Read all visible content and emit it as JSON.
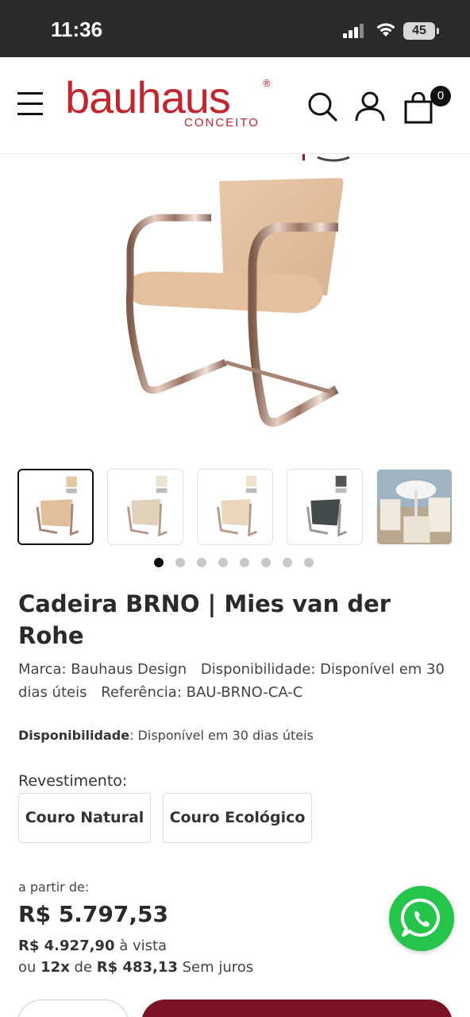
{
  "status_bar": {
    "time": "11:36",
    "battery": "45"
  },
  "header": {
    "logo_main": "bauhaus",
    "logo_sub": "CONCEITO",
    "logo_reg": "®",
    "cart_count": "0"
  },
  "gallery": {
    "thumbnail_count": 5,
    "active_thumbnail": 0,
    "dot_count": 8,
    "active_dot": 0
  },
  "product": {
    "title": "Cadeira BRNO | Mies van der Rohe",
    "brand": "Marca: Bauhaus Design",
    "availability_meta": "Disponibilidade: Disponível em 30 dias úteis",
    "reference": "Referência: BAU-BRNO-CA-C",
    "availability_label": "Disponibilidade",
    "availability_value": ": Disponível em 30 dias úteis"
  },
  "options": {
    "label": "Revestimento:",
    "items": [
      "Couro Natural",
      "Couro Ecológico"
    ]
  },
  "pricing": {
    "from_label": "a partir de:",
    "price": "R$ 5.797,53",
    "cash_price": "R$ 4.927,90",
    "cash_suffix": " à vista",
    "installments_prefix": "ou ",
    "installments_count": "12x",
    "installments_middle": " de ",
    "installment_value": "R$ 483,13",
    "installments_suffix": " Sem juros"
  },
  "colors": {
    "brand": "#c0262e",
    "buy_button": "#7a1424",
    "whatsapp": "#25c44a"
  }
}
